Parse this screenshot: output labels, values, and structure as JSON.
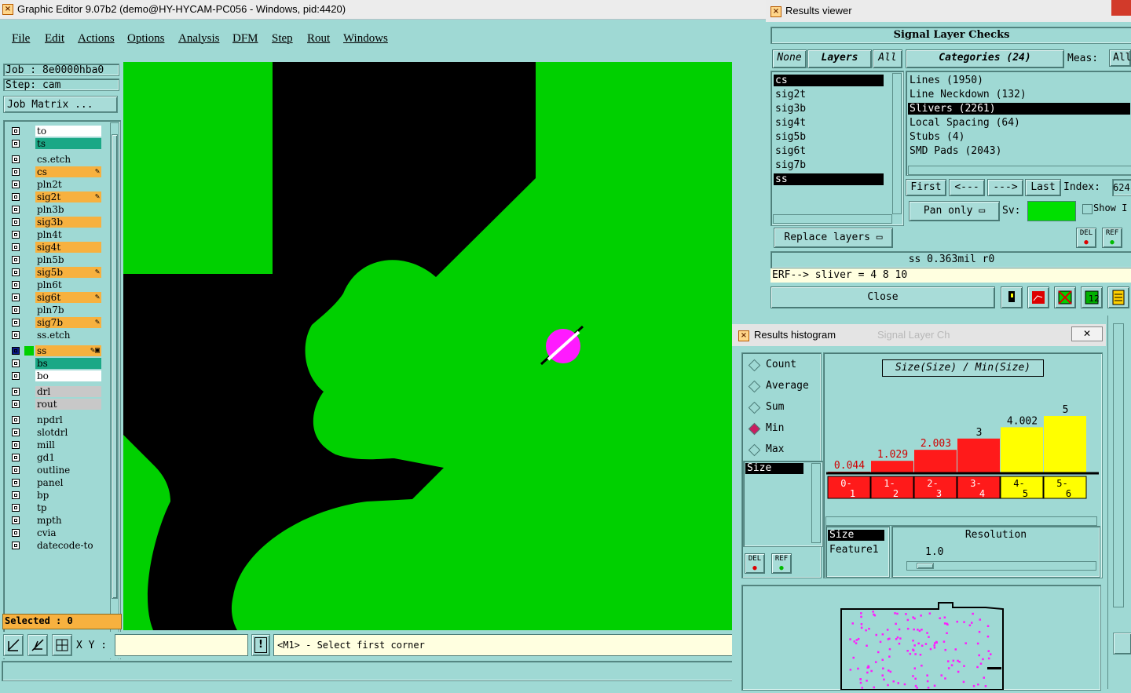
{
  "window": {
    "title": "Graphic Editor 9.07b2 (demo@HY-HYCAM-PC056 - Windows, pid:4420)"
  },
  "menu": [
    "File",
    "Edit",
    "Actions",
    "Options",
    "Analysis",
    "DFM",
    "Step",
    "Rout",
    "Windows"
  ],
  "job": {
    "label": "Job : 8e0000hba0",
    "step": "Step: cam",
    "matrix_btn": "Job Matrix ..."
  },
  "layers": [
    {
      "name": "to",
      "color": "#ffffff",
      "edit": ""
    },
    {
      "name": "ts",
      "color": "#1aa886",
      "edit": ""
    },
    {
      "name": "cs.etch",
      "color": "#9fd9d4",
      "edit": ""
    },
    {
      "name": "cs",
      "color": "#f7b13f",
      "edit": "✎"
    },
    {
      "name": "pln2t",
      "color": "#9fd9d4",
      "edit": ""
    },
    {
      "name": "sig2t",
      "color": "#f7b13f",
      "edit": "✎"
    },
    {
      "name": "pln3b",
      "color": "#9fd9d4",
      "edit": ""
    },
    {
      "name": "sig3b",
      "color": "#f7b13f",
      "edit": ""
    },
    {
      "name": "pln4t",
      "color": "#9fd9d4",
      "edit": ""
    },
    {
      "name": "sig4t",
      "color": "#f7b13f",
      "edit": ""
    },
    {
      "name": "pln5b",
      "color": "#9fd9d4",
      "edit": ""
    },
    {
      "name": "sig5b",
      "color": "#f7b13f",
      "edit": "✎"
    },
    {
      "name": "pln6t",
      "color": "#9fd9d4",
      "edit": ""
    },
    {
      "name": "sig6t",
      "color": "#f7b13f",
      "edit": "✎"
    },
    {
      "name": "pln7b",
      "color": "#9fd9d4",
      "edit": ""
    },
    {
      "name": "sig7b",
      "color": "#f7b13f",
      "edit": "✎"
    },
    {
      "name": "ss.etch",
      "color": "#9fd9d4",
      "edit": ""
    },
    {
      "name": "ss",
      "color": "#f7b13f",
      "edit": "✎▣"
    },
    {
      "name": "bs",
      "color": "#1aa886",
      "edit": ""
    },
    {
      "name": "bo",
      "color": "#ffffff",
      "edit": ""
    },
    {
      "name": "drl",
      "color": "#c8c8c8",
      "edit": ""
    },
    {
      "name": "rout",
      "color": "#c8c8c8",
      "edit": ""
    },
    {
      "name": "npdrl",
      "color": "#9fd9d4",
      "edit": ""
    },
    {
      "name": "slotdrl",
      "color": "#9fd9d4",
      "edit": ""
    },
    {
      "name": "mill",
      "color": "#9fd9d4",
      "edit": ""
    },
    {
      "name": "gd1",
      "color": "#9fd9d4",
      "edit": ""
    },
    {
      "name": "outline",
      "color": "#9fd9d4",
      "edit": ""
    },
    {
      "name": "panel",
      "color": "#9fd9d4",
      "edit": ""
    },
    {
      "name": "bp",
      "color": "#9fd9d4",
      "edit": ""
    },
    {
      "name": "tp",
      "color": "#9fd9d4",
      "edit": ""
    },
    {
      "name": "mpth",
      "color": "#9fd9d4",
      "edit": ""
    },
    {
      "name": "cvia",
      "color": "#9fd9d4",
      "edit": ""
    },
    {
      "name": "datecode-to",
      "color": "#9fd9d4",
      "edit": ""
    }
  ],
  "selected": "Selected : 0",
  "bottom": {
    "xy_label": "X Y :",
    "xy_value": "",
    "prompt": "<M1> - Select first corner",
    "excl": "!"
  },
  "results_viewer": {
    "title": "Results viewer",
    "header": "Signal Layer Checks",
    "none_btn": "None",
    "layers_btn": "Layers",
    "all_btn": "All",
    "categories_btn": "Categories (24)",
    "meas_label": "Meas:",
    "meas_value": "All",
    "layer_list": [
      "cs",
      "sig2t",
      "sig3b",
      "sig4t",
      "sig5b",
      "sig6t",
      "sig7b",
      "ss"
    ],
    "categories": [
      "Lines (1950)",
      "Line Neckdown (132)",
      "Slivers (2261)",
      "Local Spacing (64)",
      "Stubs (4)",
      "SMD Pads (2043)"
    ],
    "first_btn": "First",
    "prev_btn": "<---",
    "next_btn": "--->",
    "last_btn": "Last",
    "index_label": "Index:",
    "index_value": "624",
    "pan_btn": "Pan only",
    "sv_label": "Sv:",
    "show_label": "Show I",
    "replace_btn": "Replace layers",
    "del_lbl": "DEL",
    "ref_lbl": "REF",
    "measure": "ss 0.363mil  r0",
    "erf": "ERF--> sliver = 4 8 10",
    "close_btn": "Close"
  },
  "histogram": {
    "title": "Results histogram",
    "bg_title": "Signal Layer Ch",
    "modes": [
      "Count",
      "Average",
      "Sum",
      "Min",
      "Max"
    ],
    "selected_mode": "Min",
    "attr_list": [
      "Size"
    ],
    "formula": "Size(Size) / Min(Size)",
    "feature_list": [
      "Size",
      "Feature1"
    ],
    "resolution_label": "Resolution",
    "resolution_value": "1.0",
    "del_lbl": "DEL",
    "ref_lbl": "REF"
  },
  "chart_data": {
    "type": "bar",
    "categories": [
      "0-1",
      "1-2",
      "2-3",
      "3-4",
      "4-5",
      "5-6"
    ],
    "values": [
      0.044,
      1.029,
      2.003,
      3,
      4.002,
      5
    ],
    "labels": [
      "0.044",
      "1.029",
      "2.003",
      "3",
      "4.002",
      "5"
    ],
    "colors": [
      "#ff1a1a",
      "#ff1a1a",
      "#ff1a1a",
      "#ff1a1a",
      "#ffff00",
      "#ffff00"
    ],
    "ylim": [
      0,
      5
    ]
  }
}
